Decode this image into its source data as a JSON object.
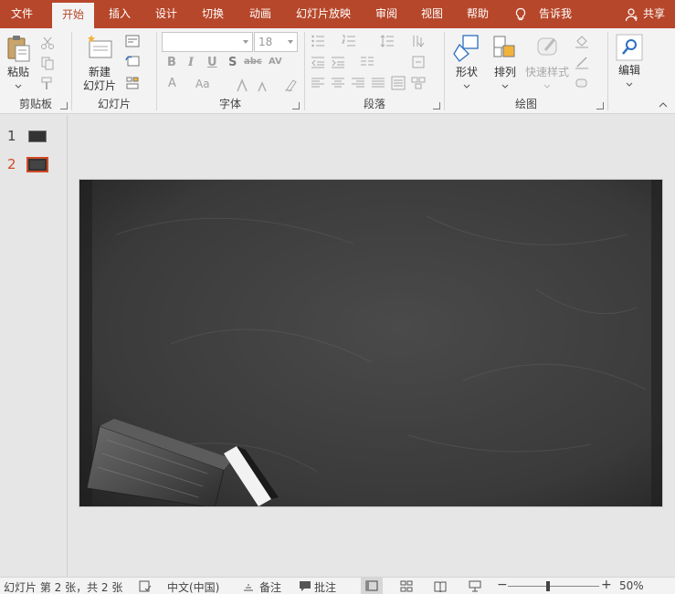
{
  "ribbon_tabs": [
    {
      "label": "文件",
      "active": false
    },
    {
      "label": "开始",
      "active": true
    },
    {
      "label": "插入",
      "active": false
    },
    {
      "label": "设计",
      "active": false
    },
    {
      "label": "切换",
      "active": false
    },
    {
      "label": "动画",
      "active": false
    },
    {
      "label": "幻灯片放映",
      "active": false
    },
    {
      "label": "审阅",
      "active": false
    },
    {
      "label": "视图",
      "active": false
    },
    {
      "label": "帮助",
      "active": false
    }
  ],
  "tell_me": "告诉我",
  "share": "共享",
  "groups": {
    "clipboard": {
      "label": "剪贴板",
      "paste": "粘贴"
    },
    "slides": {
      "label": "幻灯片",
      "new_slide_line1": "新建",
      "new_slide_line2": "幻灯片"
    },
    "font": {
      "label": "字体",
      "font_name": "",
      "font_size": "18",
      "bold": "B",
      "italic": "I",
      "underline": "U",
      "shadow": "S",
      "strike": "abc",
      "spacing": "AV",
      "font_color": "A",
      "change_case": "Aa"
    },
    "paragraph": {
      "label": "段落"
    },
    "drawing": {
      "label": "绘图",
      "shapes": "形状",
      "arrange": "排列",
      "quick_styles": "快速样式"
    },
    "editing": {
      "label": "编辑"
    }
  },
  "thumbnails": [
    {
      "number": "1",
      "active": false
    },
    {
      "number": "2",
      "active": true
    }
  ],
  "status": {
    "slide_info": "幻灯片 第 2 张，共 2 张",
    "language": "中文(中国)",
    "notes": "备注",
    "comments": "批注",
    "zoom": "50%",
    "zoom_level": 0.5
  },
  "colors": {
    "accent": "#b7472a",
    "selection": "#d04a26"
  }
}
